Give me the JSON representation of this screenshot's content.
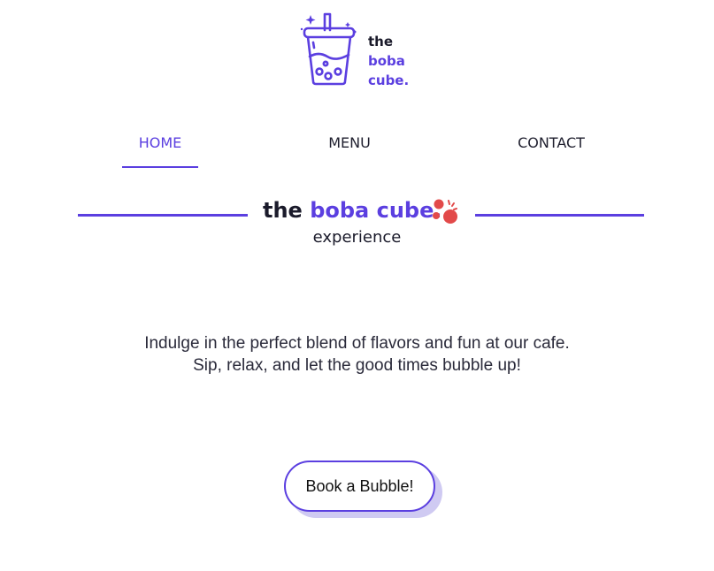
{
  "brand": {
    "logo_icon": "boba-cup-icon",
    "logo_line1": "the",
    "logo_line2": "boba",
    "logo_line3": "cube.",
    "accent_color": "#5b3fe0",
    "bubble_color": "#e24a4a"
  },
  "nav": {
    "items": [
      {
        "label": "HOME",
        "active": true
      },
      {
        "label": "MENU",
        "active": false
      },
      {
        "label": "CONTACT",
        "active": false
      }
    ]
  },
  "hero": {
    "title_dark": "the ",
    "title_accent": "boba cube.",
    "title_icon": "boba-bubbles-icon",
    "subtitle": "experience",
    "tagline_line1": "Indulge in the perfect blend of flavors and fun at our cafe.",
    "tagline_line2": "Sip, relax, and let the good times bubble up!",
    "cta_label": "Book a Bubble!"
  }
}
